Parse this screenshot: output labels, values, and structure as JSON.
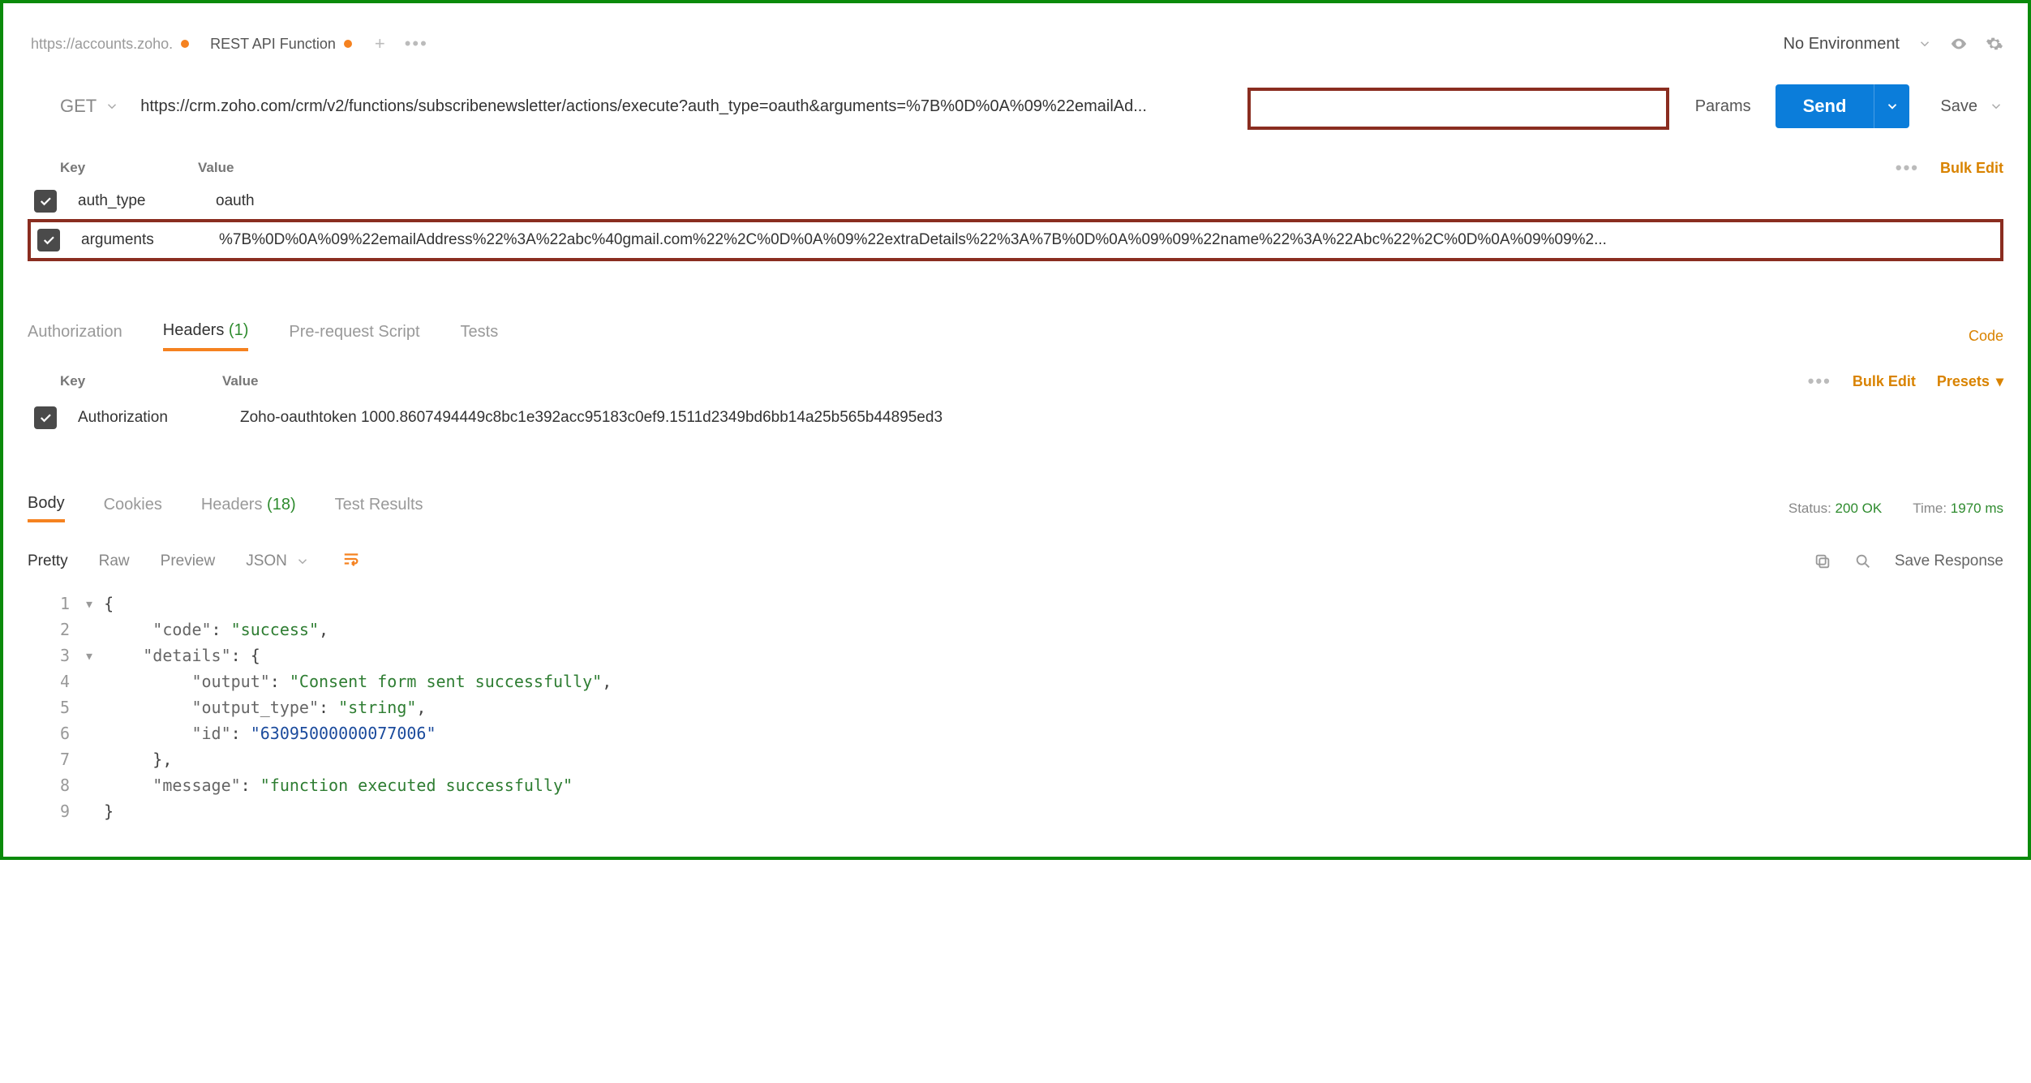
{
  "topbar": {
    "tabs": [
      {
        "label": "https://accounts.zoho.",
        "active": false
      },
      {
        "label": "REST API Function",
        "active": true
      }
    ],
    "environment": "No Environment"
  },
  "request": {
    "method": "GET",
    "url": "https://crm.zoho.com/crm/v2/functions/subscribenewsletter/actions/execute?auth_type=oauth&arguments=%7B%0D%0A%09%22emailAd...",
    "params_label": "Params",
    "send_label": "Send",
    "save_label": "Save"
  },
  "params": {
    "head_key": "Key",
    "head_value": "Value",
    "bulk_edit": "Bulk Edit",
    "rows": [
      {
        "key": "auth_type",
        "value": "oauth"
      },
      {
        "key": "arguments",
        "value": "%7B%0D%0A%09%22emailAddress%22%3A%22abc%40gmail.com%22%2C%0D%0A%09%22extraDetails%22%3A%7B%0D%0A%09%09%22name%22%3A%22Abc%22%2C%0D%0A%09%09%2..."
      }
    ]
  },
  "reqtabs": {
    "items": [
      "Authorization",
      "Headers",
      "Pre-request Script",
      "Tests"
    ],
    "headers_count": "(1)",
    "active": 1,
    "code": "Code"
  },
  "headers": {
    "head_key": "Key",
    "head_value": "Value",
    "bulk_edit": "Bulk Edit",
    "presets": "Presets",
    "rows": [
      {
        "key": "Authorization",
        "value": "Zoho-oauthtoken 1000.8607494449c8bc1e392acc95183c0ef9.1511d2349bd6bb14a25b565b44895ed3"
      }
    ]
  },
  "response": {
    "tabs": {
      "body": "Body",
      "cookies": "Cookies",
      "headers": "Headers",
      "headers_count": "(18)",
      "test_results": "Test Results"
    },
    "status_label": "Status:",
    "status_value": "200 OK",
    "time_label": "Time:",
    "time_value": "1970 ms",
    "viewmodes": {
      "pretty": "Pretty",
      "raw": "Raw",
      "preview": "Preview",
      "format": "JSON"
    },
    "save_response": "Save Response",
    "json": {
      "l1": "{",
      "l2k": "\"code\"",
      "l2v": "\"success\"",
      "l3k": "\"details\"",
      "l3v": "{",
      "l4k": "\"output\"",
      "l4v": "\"Consent form sent successfully\"",
      "l5k": "\"output_type\"",
      "l5v": "\"string\"",
      "l6k": "\"id\"",
      "l6v": "\"63095000000077006\"",
      "l7": "},",
      "l8k": "\"message\"",
      "l8v": "\"function executed successfully\"",
      "l9": "}"
    }
  }
}
